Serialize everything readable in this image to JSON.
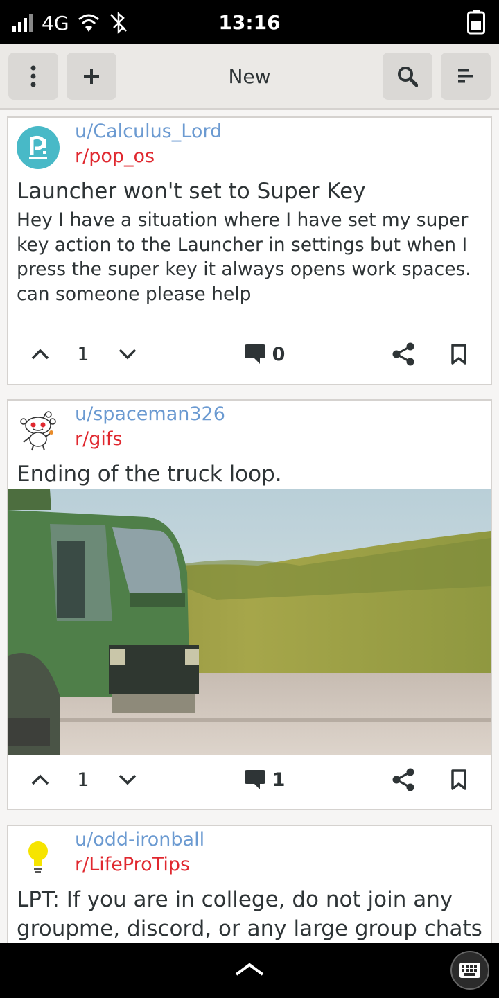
{
  "status": {
    "network": "4G",
    "time": "13:16"
  },
  "header": {
    "title": "New",
    "buttons": [
      "menu-icon",
      "add-icon",
      "search-icon",
      "sort-icon"
    ]
  },
  "posts": [
    {
      "user": "u/Calculus_Lord",
      "subreddit": "r/pop_os",
      "title": "Launcher won't set to Super Key",
      "body": "Hey I have a situation where I have set my super key action to the Launcher in settings but when I press the super key it always opens work spaces. can someone please help",
      "score": "1",
      "comments": "0"
    },
    {
      "user": "u/spaceman326",
      "subreddit": "r/gifs",
      "title": "Ending of the truck loop.",
      "score": "1",
      "comments": "1"
    },
    {
      "user": "u/odd-ironball",
      "subreddit": "r/LifeProTips",
      "title_lines": [
        "LPT: If you are in college, do not join any",
        "groupme, discord, or any large group chats"
      ]
    }
  ],
  "colors": {
    "username": "#6b9ad1",
    "subreddit": "#e0282f",
    "text": "#2e3436"
  }
}
